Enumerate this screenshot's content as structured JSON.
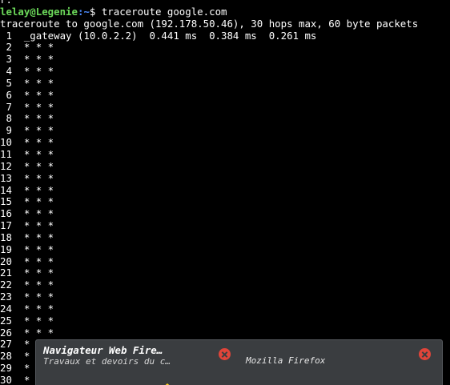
{
  "terminal": {
    "top_fragment": "r.",
    "prompt_user": "lelay@Legenie",
    "prompt_path": ":~",
    "prompt_symbol": "$ ",
    "command": "traceroute google.com",
    "output_header": "traceroute to google.com (192.178.50.46), 30 hops max, 60 byte packets",
    "hops": [
      " 1  _gateway (10.0.2.2)  0.441 ms  0.384 ms  0.261 ms",
      " 2  * * *",
      " 3  * * *",
      " 4  * * *",
      " 5  * * *",
      " 6  * * *",
      " 7  * * *",
      " 8  * * *",
      " 9  * * *",
      "10  * * *",
      "11  * * *",
      "12  * * *",
      "13  * * *",
      "14  * * *",
      "15  * * *",
      "16  * * *",
      "17  * * *",
      "18  * * *",
      "19  * * *",
      "20  * * *",
      "21  * * *",
      "22  * * *",
      "23  * * *",
      "24  * * *",
      "25  * * *",
      "26  * * *",
      "27  * * *",
      "28  * * *",
      "29  * * *",
      "30  * * *"
    ]
  },
  "window_switcher": {
    "windows": [
      {
        "title": "Navigateur Web Fire…",
        "subtitle": "Travaux et devoirs du c…"
      },
      {
        "title": "Mozilla Firefox"
      }
    ]
  },
  "colors": {
    "background": "#000000",
    "foreground": "#ffffff",
    "prompt_user": "#6cd95a",
    "prompt_path": "#4d8cff",
    "popup_bg": "#3a3d40",
    "close_red": "#e0453a"
  }
}
